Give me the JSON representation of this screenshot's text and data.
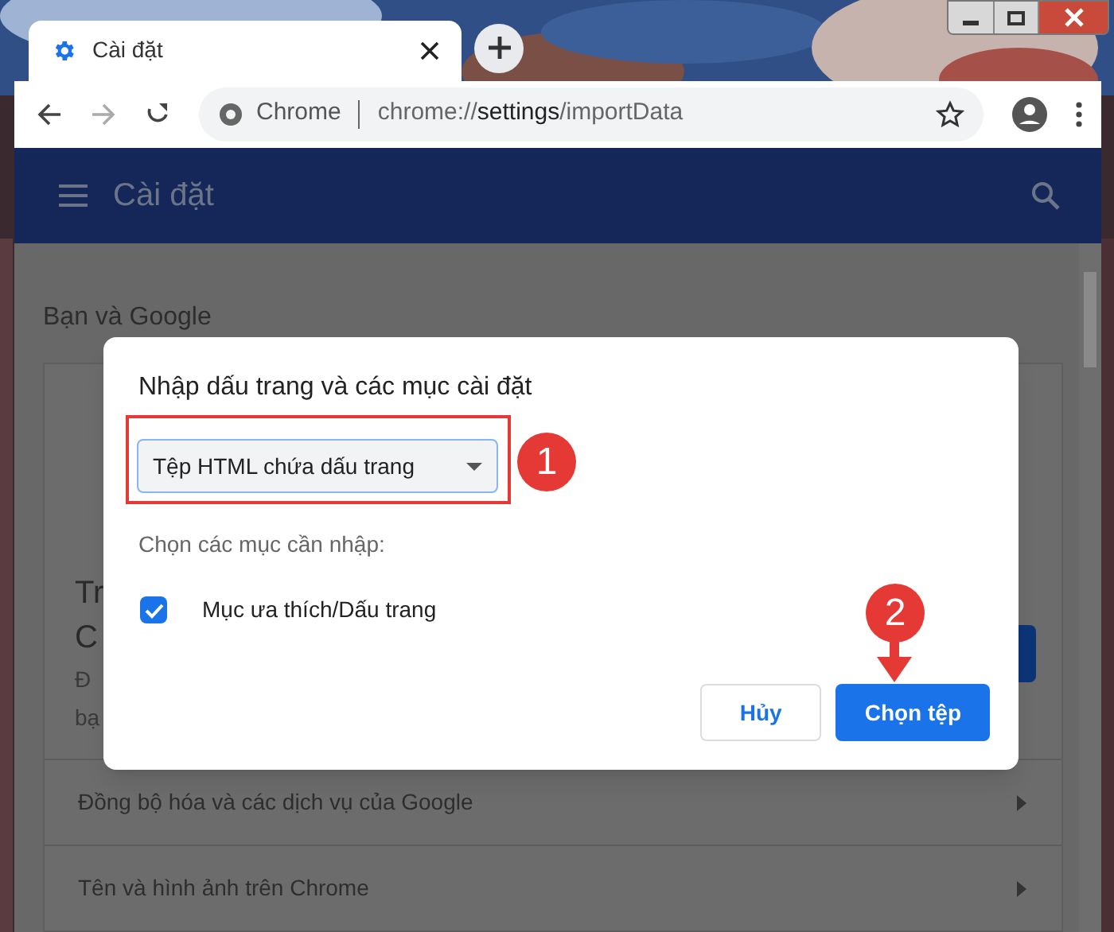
{
  "tab": {
    "title": "Cài đặt"
  },
  "address_bar": {
    "site": "Chrome",
    "url_scheme": "chrome://",
    "url_host": "settings",
    "url_path": "/importData"
  },
  "header": {
    "title": "Cài đặt"
  },
  "section_title": "Bạn và Google",
  "card_fragments": [
    "Tr",
    "C",
    "Đ",
    "bạ"
  ],
  "rows": [
    {
      "label": "Đồng bộ hóa và các dịch vụ của Google"
    },
    {
      "label": "Tên và hình ảnh trên Chrome"
    }
  ],
  "dialog": {
    "title": "Nhập dấu trang và các mục cài đặt",
    "source_select": {
      "value": "Tệp HTML chứa dấu trang"
    },
    "items_label": "Chọn các mục cần nhập:",
    "items": [
      {
        "label": "Mục ưa thích/Dấu trang",
        "checked": true
      }
    ],
    "buttons": [
      {
        "label": "Hủy",
        "kind": "secondary"
      },
      {
        "label": "Chọn tệp",
        "kind": "primary"
      }
    ]
  },
  "annotations": [
    "1",
    "2"
  ]
}
